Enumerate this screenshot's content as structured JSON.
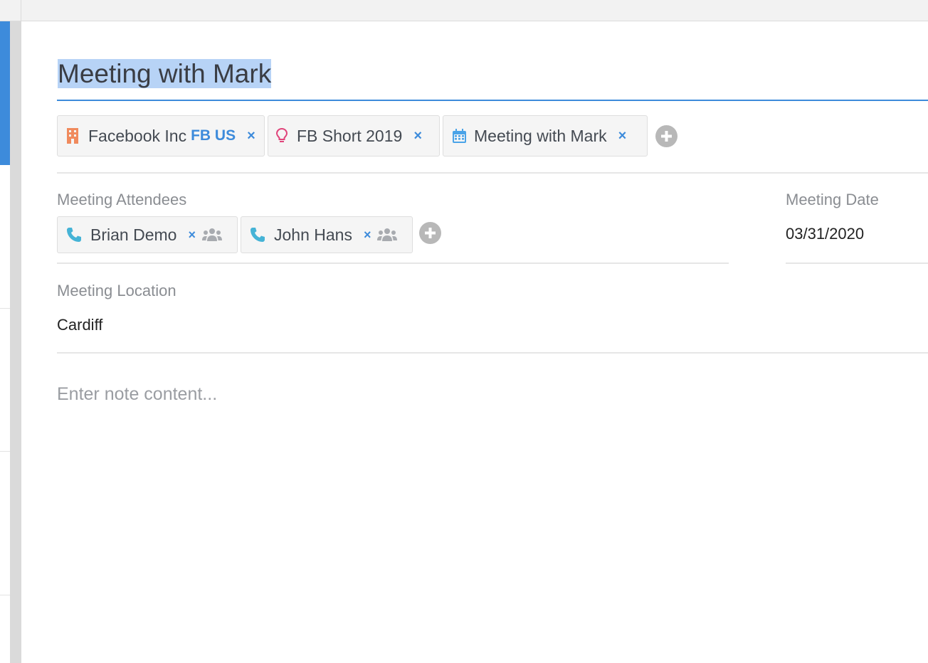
{
  "note": {
    "title": "Meeting with Mark",
    "placeholder": "Enter note content..."
  },
  "tags": [
    {
      "label": "Facebook Inc",
      "badge": "FB US",
      "icon": "building-icon",
      "color": "#f08a5d"
    },
    {
      "label": "FB Short 2019",
      "icon": "lightbulb-icon",
      "color": "#e0457b"
    },
    {
      "label": "Meeting with Mark",
      "icon": "calendar-icon",
      "color": "#4aa3e8"
    }
  ],
  "attendees": {
    "label": "Meeting Attendees",
    "items": [
      {
        "name": "Brian Demo",
        "icon": "phone-icon"
      },
      {
        "name": "John Hans",
        "icon": "phone-icon"
      }
    ]
  },
  "meeting_date": {
    "label": "Meeting Date",
    "value": "03/31/2020"
  },
  "meeting_location": {
    "label": "Meeting Location",
    "value": "Cardiff"
  },
  "colors": {
    "accent": "#3d8bdb",
    "phone": "#45b3d6",
    "group": "#a8abb0"
  }
}
